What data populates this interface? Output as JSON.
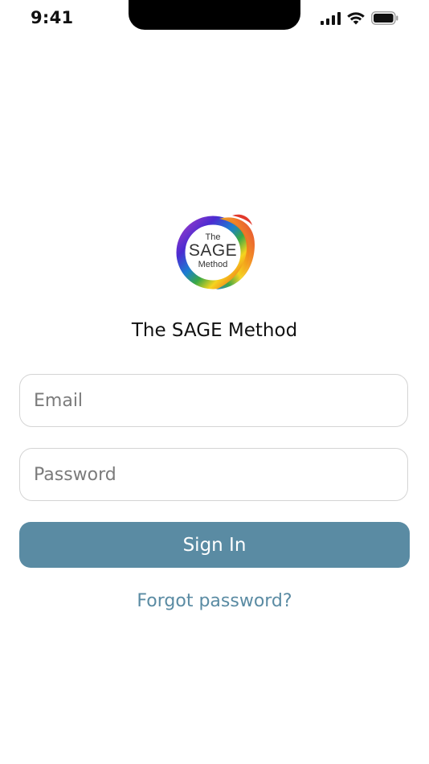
{
  "status_bar": {
    "time": "9:41",
    "signal_icon": "cellular-signal-icon",
    "wifi_icon": "wifi-icon",
    "battery_icon": "battery-icon"
  },
  "logo": {
    "line1": "The",
    "line2": "SAGE",
    "line3": "Method",
    "ring_colors": [
      "#e2392b",
      "#f28a1b",
      "#f5d41f",
      "#39a845",
      "#1c7fd1",
      "#4b2bd1",
      "#a23cc9"
    ]
  },
  "app_title": "The SAGE Method",
  "form": {
    "email_placeholder": "Email",
    "email_value": "",
    "password_placeholder": "Password",
    "password_value": "",
    "sign_in_label": "Sign In",
    "forgot_label": "Forgot password?"
  },
  "colors": {
    "accent": "#5a8ba3",
    "field_border": "#d4d4d4",
    "placeholder": "#7b7b7b"
  }
}
